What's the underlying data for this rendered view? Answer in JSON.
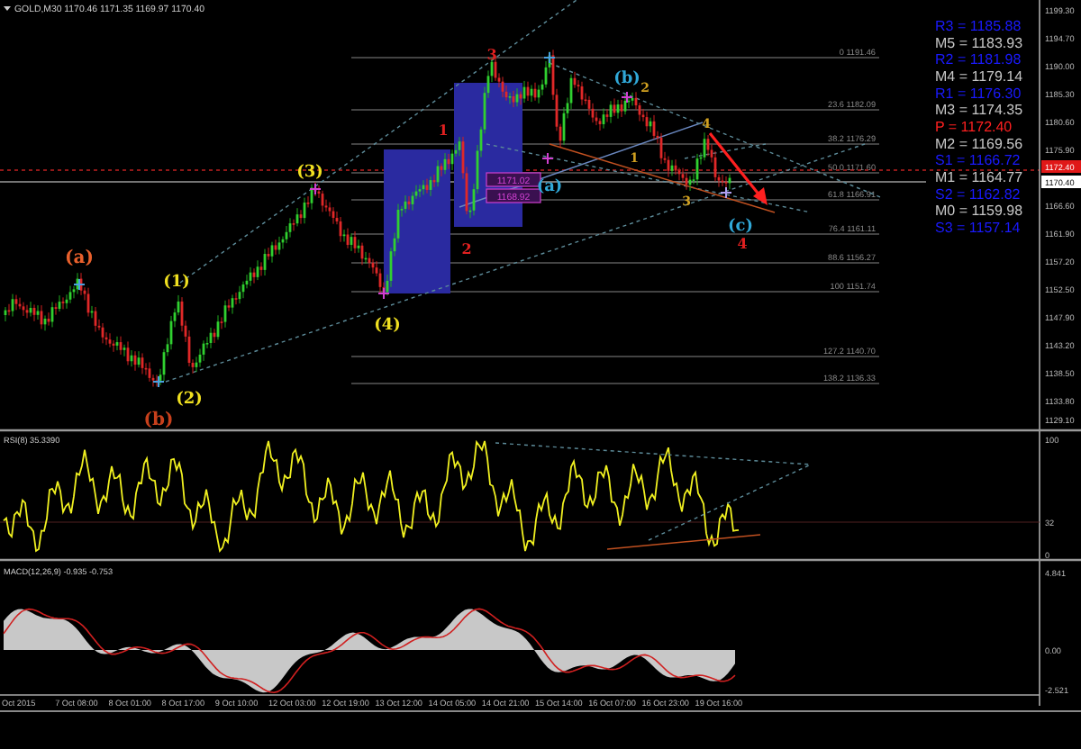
{
  "chart_header": {
    "symbol": "GOLD,M30",
    "quotes": [
      "1170.46",
      "1171.35",
      "1169.97",
      "1170.40"
    ]
  },
  "wave_labels": [
    {
      "text": "(a)",
      "color": "#e8602c"
    },
    {
      "text": "(b)",
      "color": "#c8401c"
    },
    {
      "text": "(1)",
      "color": "#f0e020"
    },
    {
      "text": "(2)",
      "color": "#f0e020"
    },
    {
      "text": "(3)",
      "color": "#f0e020"
    },
    {
      "text": "(4)",
      "color": "#f0e020"
    },
    {
      "text": "1",
      "color": "#e02020"
    },
    {
      "text": "2",
      "color": "#e02020"
    },
    {
      "text": "3",
      "color": "#e02020"
    },
    {
      "text": "(a)",
      "color": "#30a8d8"
    },
    {
      "text": "(b)",
      "color": "#30a8d8"
    },
    {
      "text": "(c)",
      "color": "#30a8d8"
    },
    {
      "text": "2",
      "color": "#d0a020"
    },
    {
      "text": "1",
      "color": "#d0a020"
    },
    {
      "text": "3",
      "color": "#d0a020"
    },
    {
      "text": "4",
      "color": "#d0a020"
    },
    {
      "text": "4",
      "color": "#e02020"
    }
  ],
  "fib_levels": [
    "0 1191.46",
    "23.6 1182.09",
    "38.2 1176.29",
    "50.0 1171.60",
    "61.8 1166.91",
    "76.4 1161.11",
    "88.6 1156.27",
    "100 1151.74",
    "127.2 1140.70",
    "138.2 1136.33"
  ],
  "price_boxes": [
    "1171.02",
    "1168.92"
  ],
  "pivot_levels": [
    {
      "text": "R3 = 1185.88",
      "kind": "resistance"
    },
    {
      "text": "M5 = 1183.93",
      "kind": "mid"
    },
    {
      "text": "R2 = 1181.98",
      "kind": "resistance"
    },
    {
      "text": "M4 = 1179.14",
      "kind": "mid"
    },
    {
      "text": "R1 = 1176.30",
      "kind": "resistance"
    },
    {
      "text": "M3 = 1174.35",
      "kind": "mid"
    },
    {
      "text": "P  = 1172.40",
      "kind": "pivot"
    },
    {
      "text": "M2 = 1169.56",
      "kind": "mid"
    },
    {
      "text": "S1 = 1166.72",
      "kind": "support"
    },
    {
      "text": "M1 = 1164.77",
      "kind": "mid"
    },
    {
      "text": "S2 = 1162.82",
      "kind": "support"
    },
    {
      "text": "M0 = 1159.98",
      "kind": "mid"
    },
    {
      "text": "S3 = 1157.14",
      "kind": "support"
    }
  ],
  "price_axis": {
    "ticks": [
      "1199.30",
      "1194.70",
      "1190.00",
      "1185.30",
      "1180.60",
      "1175.90",
      "1166.60",
      "1161.90",
      "1157.20",
      "1152.50",
      "1147.90",
      "1143.20",
      "1138.50",
      "1133.80",
      "1129.10"
    ],
    "pivot_marker": "1172.40",
    "bid_marker": "1170.40"
  },
  "rsi": {
    "label": "RSI(8) 35.3390",
    "ticks": [
      "100",
      "32",
      "0"
    ]
  },
  "macd": {
    "label": "MACD(12,26,9) -0.935 -0.753",
    "ticks": [
      "4.841",
      "0.00",
      "-2.521"
    ]
  },
  "time_axis": [
    "Oct 2015",
    "7 Oct 08:00",
    "8 Oct 01:00",
    "8 Oct 17:00",
    "9 Oct 10:00",
    "12 Oct 03:00",
    "12 Oct 19:00",
    "13 Oct 12:00",
    "14 Oct 05:00",
    "14 Oct 21:00",
    "15 Oct 14:00",
    "16 Oct 07:00",
    "16 Oct 23:00",
    "19 Oct 16:00"
  ]
}
